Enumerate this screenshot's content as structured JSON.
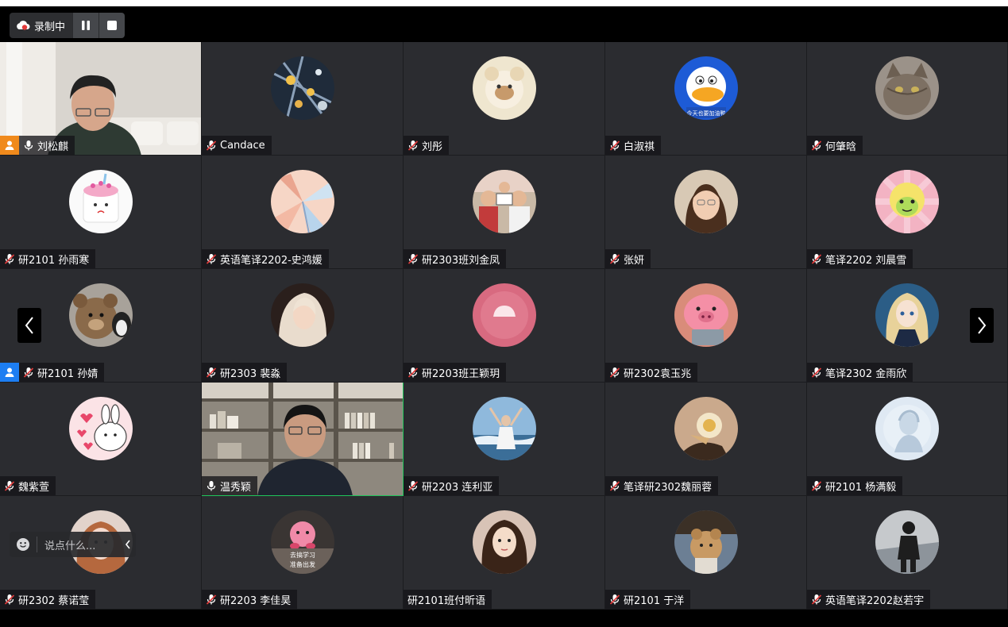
{
  "recording": {
    "label": "录制中",
    "accent": "#e33b3b"
  },
  "chat": {
    "placeholder": "说点什么..."
  },
  "colors": {
    "tile_bg": "#2b2c30",
    "speaking_border": "#1fc65a",
    "host_badge": "#f08a1c",
    "cohost_badge": "#1d7ef2"
  },
  "participants": [
    {
      "name": "刘松麒"
    },
    {
      "name": "Candace"
    },
    {
      "name": "刘彤"
    },
    {
      "name": "白淑祺"
    },
    {
      "name": "何肇晗"
    },
    {
      "name": "研2101 孙雨寒"
    },
    {
      "name": "英语笔译2202-史鸿媛"
    },
    {
      "name": "研2303班刘金凤"
    },
    {
      "name": "张妍"
    },
    {
      "name": "笔译2202 刘晨雪"
    },
    {
      "name": "研2101 孙婧"
    },
    {
      "name": "研2303 裴淼"
    },
    {
      "name": "研2203班王颖玥"
    },
    {
      "name": "研2302袁玉兆"
    },
    {
      "name": "笔译2302 金雨欣"
    },
    {
      "name": "魏紫萱"
    },
    {
      "name": "温秀颖"
    },
    {
      "name": "研2203 连利亚"
    },
    {
      "name": "笔译研2302魏丽蓉"
    },
    {
      "name": "研2101 杨满毅"
    },
    {
      "name": "研2302 蔡诺莹"
    },
    {
      "name": "研2203 李佳昊"
    },
    {
      "name": "研2101班付昕语"
    },
    {
      "name": "研2101 于洋"
    },
    {
      "name": "英语笔译2202赵若宇"
    }
  ],
  "avatar_texts": {
    "donald": "今天也要加油鸭",
    "study_line1": "去搞学习",
    "study_line2": "准备出发"
  }
}
